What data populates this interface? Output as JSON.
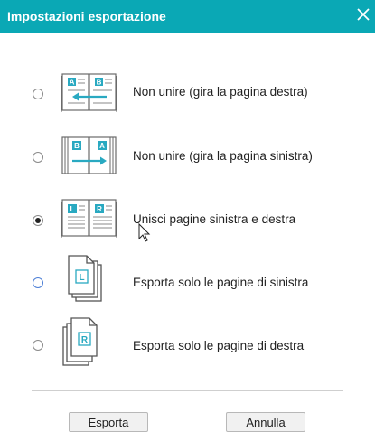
{
  "dialog": {
    "title": "Impostazioni esportazione"
  },
  "options": [
    {
      "label": "Non unire (gira la pagina destra)",
      "selected": false,
      "icon": "book-spread-turn-right-icon",
      "letters": [
        "A",
        "B"
      ]
    },
    {
      "label": "Non unire (gira la pagina sinistra)",
      "selected": false,
      "icon": "book-spread-turn-left-icon",
      "letters": [
        "B",
        "A"
      ]
    },
    {
      "label": "Unisci pagine sinistra e destra",
      "selected": true,
      "icon": "book-spread-merge-icon",
      "letters": [
        "L",
        "R"
      ]
    },
    {
      "label": "Esporta solo le pagine di sinistra",
      "selected": false,
      "icon": "page-stack-left-icon",
      "letters": [
        "L"
      ]
    },
    {
      "label": "Esporta solo le pagine di destra",
      "selected": false,
      "icon": "page-stack-right-icon",
      "letters": [
        "R"
      ]
    }
  ],
  "buttons": {
    "export": "Esporta",
    "cancel": "Annulla"
  },
  "colors": {
    "titlebar": "#0aa8b5",
    "accent": "#29a9c1",
    "icon_stroke": "#6a6a6a"
  }
}
